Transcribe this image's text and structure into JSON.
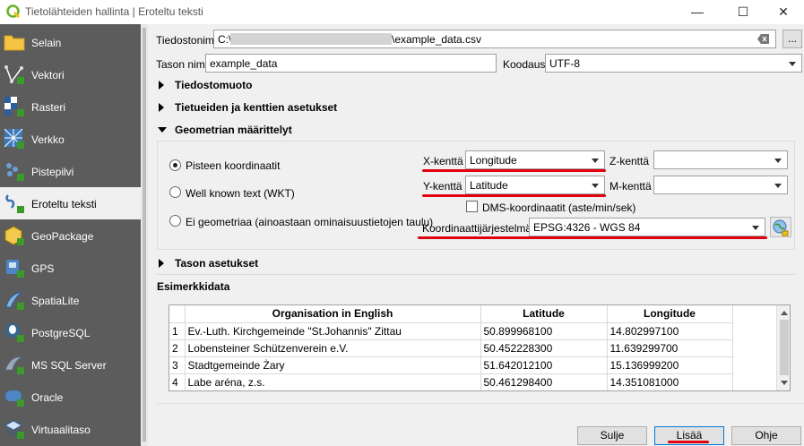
{
  "window": {
    "title": "Tietolähteiden hallinta | Eroteltu teksti",
    "minimize": "—",
    "maximize": "☐",
    "close": "✕"
  },
  "sidebar": {
    "items": [
      {
        "label": "Selain",
        "icon": "folder-icon"
      },
      {
        "label": "Vektori",
        "icon": "vector-icon"
      },
      {
        "label": "Rasteri",
        "icon": "raster-icon"
      },
      {
        "label": "Verkko",
        "icon": "mesh-icon"
      },
      {
        "label": "Pistepilvi",
        "icon": "point-cloud-icon"
      },
      {
        "label": "Eroteltu teksti",
        "icon": "delimited-text-icon"
      },
      {
        "label": "GeoPackage",
        "icon": "geopackage-icon"
      },
      {
        "label": "GPS",
        "icon": "gps-icon"
      },
      {
        "label": "SpatiaLite",
        "icon": "spatialite-icon"
      },
      {
        "label": "PostgreSQL",
        "icon": "postgresql-icon"
      },
      {
        "label": "MS SQL Server",
        "icon": "mssql-icon"
      },
      {
        "label": "Oracle",
        "icon": "oracle-icon"
      },
      {
        "label": "Virtuaalitaso",
        "icon": "virtual-layer-icon"
      }
    ],
    "active_index": 5
  },
  "form": {
    "file_label": "Tiedostonimi",
    "file_prefix": "C:\\",
    "file_suffix": "\\example_data.csv",
    "browse_label": "...",
    "layer_name_label": "Tason nimi",
    "layer_name_value": "example_data",
    "encoding_label": "Koodaus",
    "encoding_value": "UTF-8"
  },
  "sections": {
    "file_format": "Tiedostomuoto",
    "record_fields": "Tietueiden ja kenttien asetukset",
    "geometry": "Geometrian määrittelyt",
    "layer_settings": "Tason asetukset",
    "sample_data": "Esimerkkidata"
  },
  "geometry": {
    "radio_point": "Pisteen koordinaatit",
    "radio_wkt": "Well known text (WKT)",
    "radio_none": "Ei geometriaa (ainoastaan ominaisuustietojen taulu)",
    "x_label": "X-kenttä",
    "x_value": "Longitude",
    "y_label": "Y-kenttä",
    "y_value": "Latitude",
    "z_label": "Z-kenttä",
    "z_value": "",
    "m_label": "M-kenttä",
    "m_value": "",
    "dms_label": "DMS-koordinaatit (aste/min/sek)",
    "crs_label": "Koordinaattijärjestelmä",
    "crs_value": "EPSG:4326 - WGS 84",
    "highlight_color": "#e0000e"
  },
  "table": {
    "headers": [
      "",
      "Organisation in English",
      "Latitude",
      "Longitude"
    ],
    "rows": [
      [
        "1",
        "Ev.-Luth. Kirchgemeinde \"St.Johannis\" Zittau",
        "50.899968100",
        "14.802997100"
      ],
      [
        "2",
        "Lobensteiner Schützenverein e.V.",
        "50.452228300",
        "11.639299700"
      ],
      [
        "3",
        "Stadtgemeinde Żary",
        "51.642012100",
        "15.136999200"
      ],
      [
        "4",
        "Labe aréna, z.s.",
        "50.461298400",
        "14.351081000"
      ]
    ]
  },
  "buttons": {
    "close": "Sulje",
    "add": "Lisää",
    "help": "Ohje"
  }
}
